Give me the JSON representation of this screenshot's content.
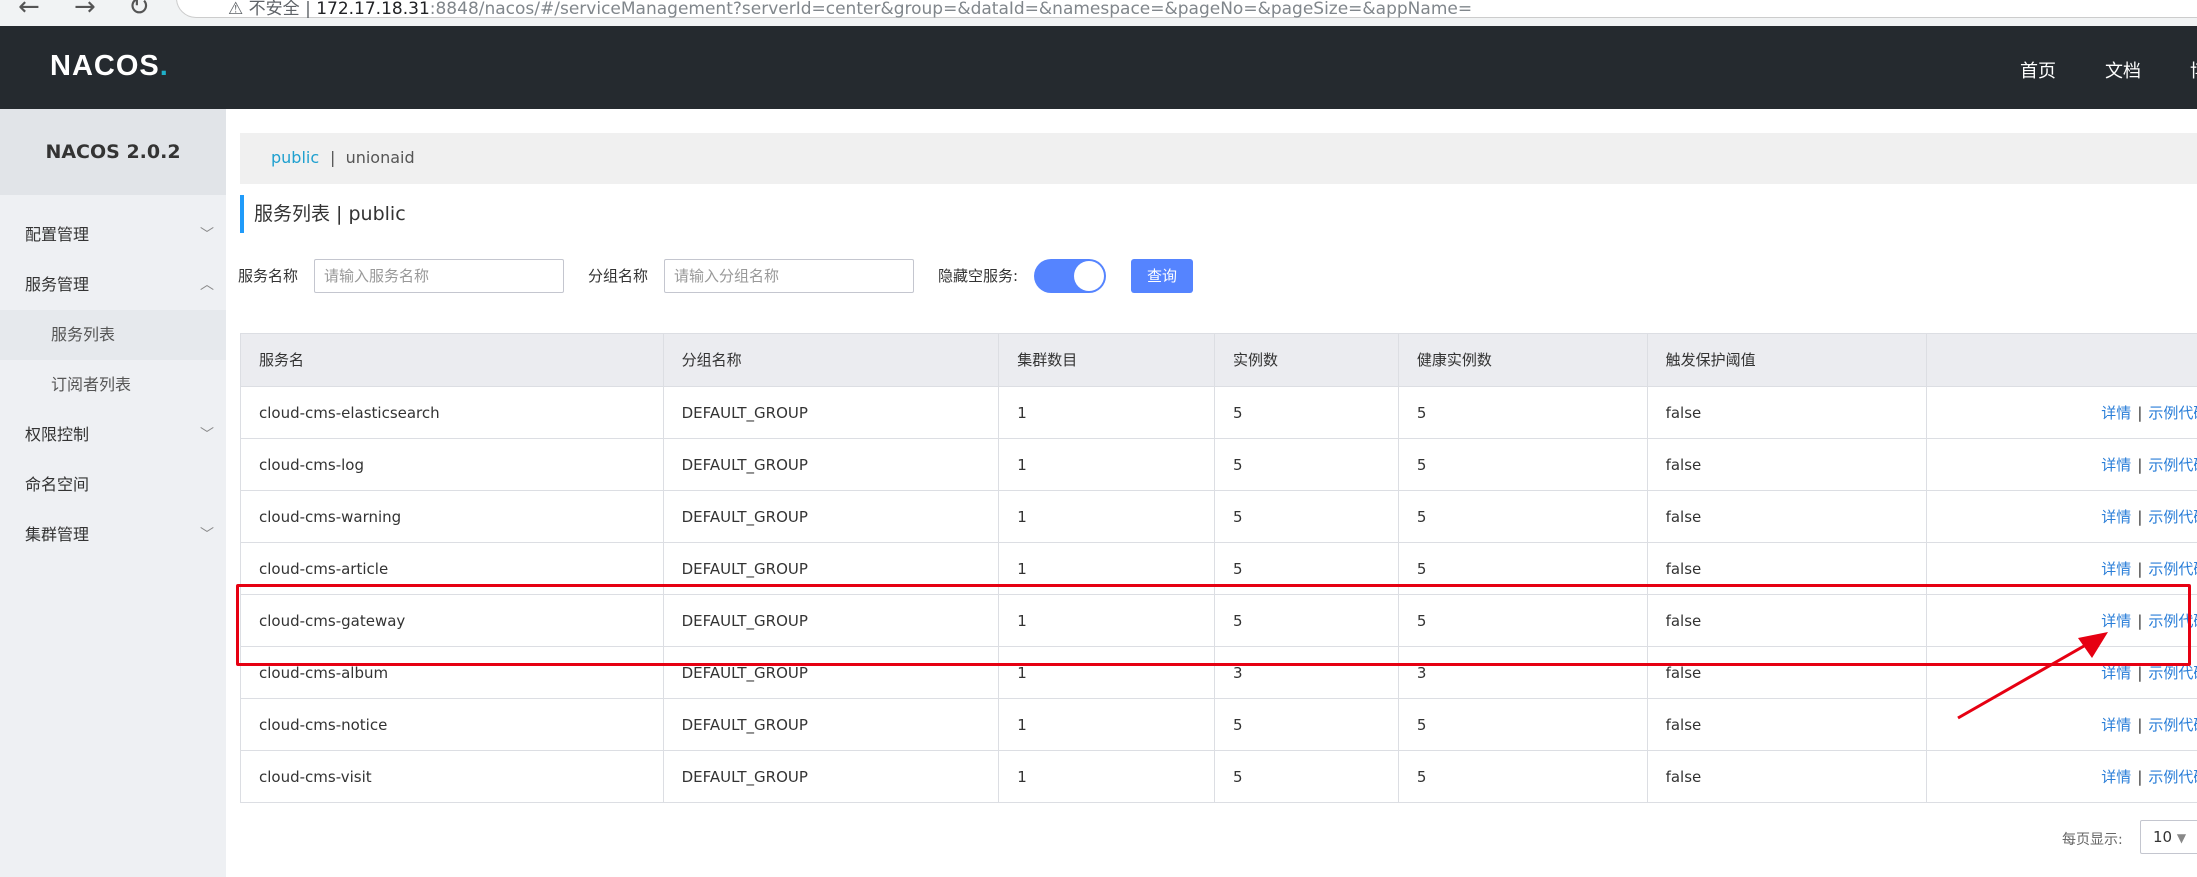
{
  "browser": {
    "warning_label": "不安全",
    "url_host": "172.17.18.31",
    "url_path": ":8848/nacos/#/serviceManagement?serverId=center&group=&dataId=&namespace=&pageNo=&pageSize=&appName="
  },
  "header": {
    "logo_main": "NACOS",
    "logo_dot": ".",
    "nav": [
      "首页",
      "文档",
      "博"
    ]
  },
  "sidebar": {
    "title": "NACOS 2.0.2",
    "items": [
      {
        "label": "配置管理",
        "chevron": "chevron-down"
      },
      {
        "label": "服务管理",
        "chevron": "chevron-up"
      },
      {
        "label": "服务列表",
        "sub": true,
        "active": true
      },
      {
        "label": "订阅者列表",
        "sub": true
      },
      {
        "label": "权限控制",
        "chevron": "chevron-down"
      },
      {
        "label": "命名空间"
      },
      {
        "label": "集群管理",
        "chevron": "chevron-down"
      }
    ]
  },
  "namespace": {
    "current": "public",
    "separator": "|",
    "other": "unionaid"
  },
  "page": {
    "title": "服务列表 | public"
  },
  "filters": {
    "service_name_label": "服务名称",
    "service_name_placeholder": "请输入服务名称",
    "group_name_label": "分组名称",
    "group_name_placeholder": "请输入分组名称",
    "hide_empty_label": "隐藏空服务:",
    "hide_empty_on": true,
    "query_label": "查询"
  },
  "table": {
    "headers": [
      "服务名",
      "分组名称",
      "集群数目",
      "实例数",
      "健康实例数",
      "触发保护阈值",
      ""
    ],
    "detail_label": "详情",
    "sample_label": "示例代码",
    "rows": [
      {
        "name": "cloud-cms-elasticsearch",
        "group": "DEFAULT_GROUP",
        "clusters": "1",
        "instances": "5",
        "healthy": "5",
        "threshold": "false"
      },
      {
        "name": "cloud-cms-log",
        "group": "DEFAULT_GROUP",
        "clusters": "1",
        "instances": "5",
        "healthy": "5",
        "threshold": "false"
      },
      {
        "name": "cloud-cms-warning",
        "group": "DEFAULT_GROUP",
        "clusters": "1",
        "instances": "5",
        "healthy": "5",
        "threshold": "false"
      },
      {
        "name": "cloud-cms-article",
        "group": "DEFAULT_GROUP",
        "clusters": "1",
        "instances": "5",
        "healthy": "5",
        "threshold": "false"
      },
      {
        "name": "cloud-cms-gateway",
        "group": "DEFAULT_GROUP",
        "clusters": "1",
        "instances": "5",
        "healthy": "5",
        "threshold": "false"
      },
      {
        "name": "cloud-cms-album",
        "group": "DEFAULT_GROUP",
        "clusters": "1",
        "instances": "3",
        "healthy": "3",
        "threshold": "false"
      },
      {
        "name": "cloud-cms-notice",
        "group": "DEFAULT_GROUP",
        "clusters": "1",
        "instances": "5",
        "healthy": "5",
        "threshold": "false"
      },
      {
        "name": "cloud-cms-visit",
        "group": "DEFAULT_GROUP",
        "clusters": "1",
        "instances": "5",
        "healthy": "5",
        "threshold": "false"
      }
    ]
  },
  "pagination": {
    "page_size_label": "每页显示:",
    "page_size": "10"
  },
  "colors": {
    "header_bg": "#252a2f",
    "accent": "#5584ff",
    "link": "#2a7ed8",
    "annotation": "#e60012"
  }
}
